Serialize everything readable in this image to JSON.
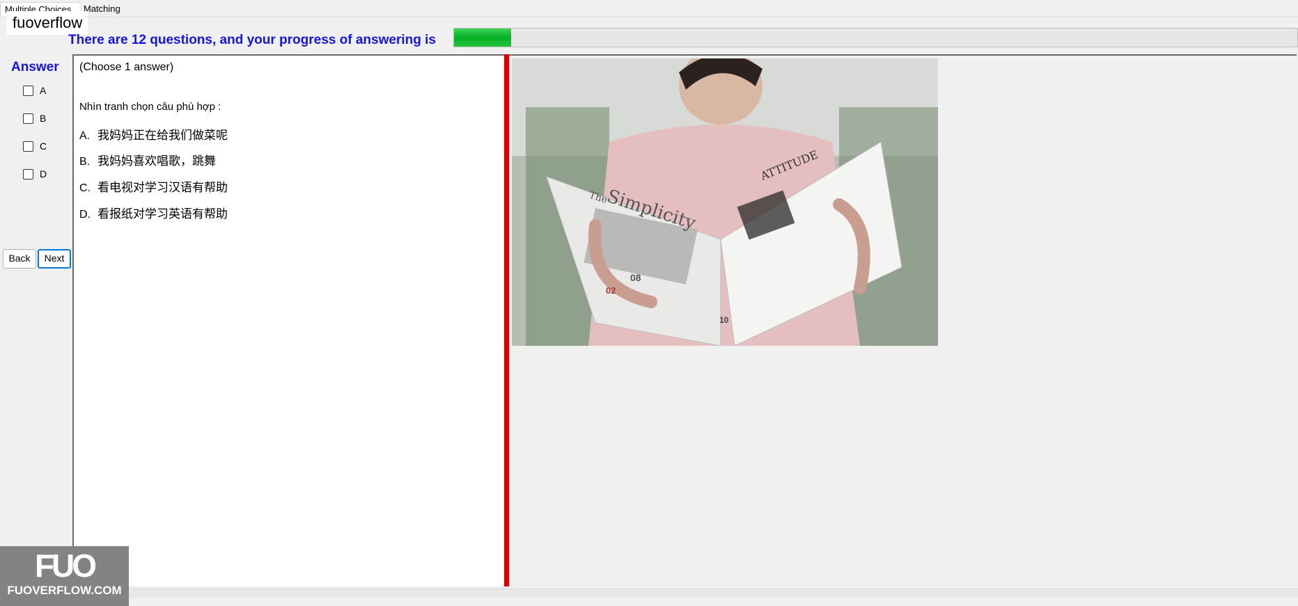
{
  "tabs": [
    "Multiple Choices",
    "Matching"
  ],
  "watermark_top": "fuoverflow",
  "progress": {
    "text": "There are 12 questions, and your progress of answering is",
    "fraction": 0.068,
    "fill_color": "#06b025"
  },
  "answer_panel": {
    "title": "Answer",
    "options": [
      "A",
      "B",
      "C",
      "D"
    ],
    "back_label": "Back",
    "next_label": "Next"
  },
  "question": {
    "instruction": "(Choose 1 answer)",
    "prompt": "Nhìn tranh chọn câu phù hợp :",
    "options": [
      {
        "letter": "A.",
        "text": "我妈妈正在给我们做菜呢"
      },
      {
        "letter": "B.",
        "text": "我妈妈喜欢唱歌，跳舞"
      },
      {
        "letter": "C.",
        "text": "看电视对学习汉语有帮助"
      },
      {
        "letter": "D.",
        "text": "看报纸对学习英语有帮助"
      }
    ]
  },
  "image": {
    "subject": "woman reading a magazine",
    "magazine_title": "Simplicity",
    "magazine_prefix": "The",
    "page_heading": "ATTITUDE",
    "page_numbers": [
      "08",
      "02",
      "10"
    ]
  },
  "logo": {
    "mark": "FUO",
    "text": "FUOVERFLOW.COM"
  },
  "colors": {
    "accent_blue": "#1414f0",
    "divider_red": "#e00000"
  }
}
